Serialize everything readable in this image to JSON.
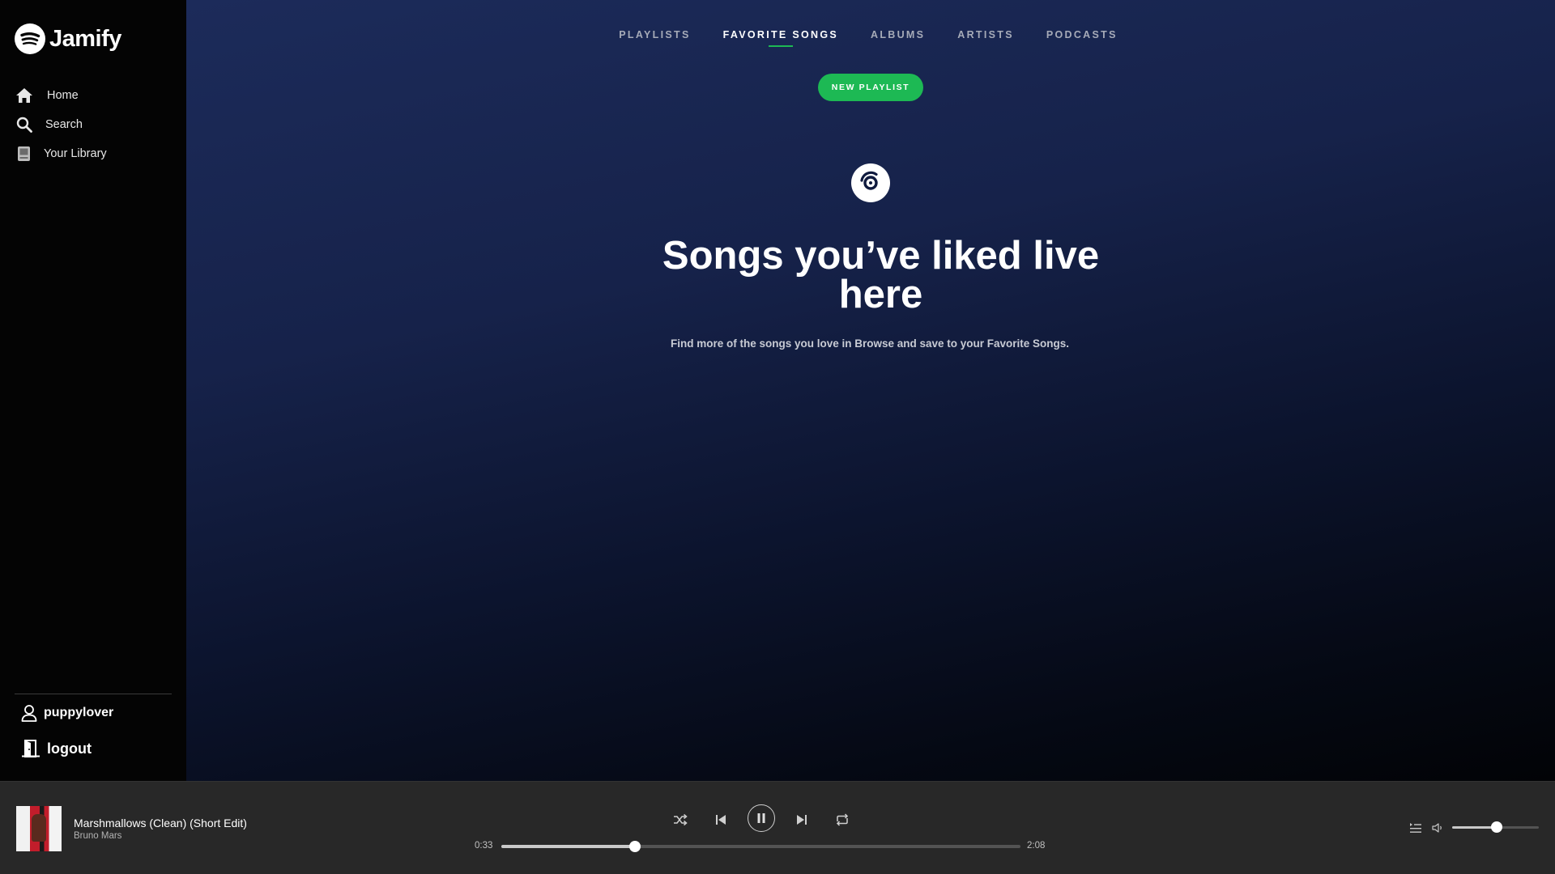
{
  "app": {
    "name": "Jamify",
    "logo_icon": "jamify-logo-icon",
    "accent_color": "#1db954"
  },
  "sidebar": {
    "items": [
      {
        "label": "Home",
        "icon": "home-icon"
      },
      {
        "label": "Search",
        "icon": "search-icon"
      },
      {
        "label": "Your Library",
        "icon": "library-icon"
      }
    ],
    "user": {
      "name": "puppylover",
      "icon": "user-icon"
    },
    "logout": {
      "label": "logout",
      "icon": "logout-door-icon"
    }
  },
  "main": {
    "tabs": [
      {
        "label": "PLAYLISTS",
        "active": false
      },
      {
        "label": "FAVORITE SONGS",
        "active": true
      },
      {
        "label": "ALBUMS",
        "active": false
      },
      {
        "label": "ARTISTS",
        "active": false
      },
      {
        "label": "PODCASTS",
        "active": false
      }
    ],
    "new_playlist_label": "NEW PLAYLIST",
    "empty_state": {
      "icon": "album-disc-icon",
      "headline_line1": "Songs you’ve liked live",
      "headline_line2": "here",
      "subtext": "Find more of the songs you love in Browse and save to your Favorite Songs."
    }
  },
  "player": {
    "track_title": "Marshmallows (Clean) (Short Edit)",
    "artist": "Bruno Mars",
    "cover_icon": "album-cover-image",
    "current_time": "0:33",
    "total_time": "2:08",
    "progress_fraction": 0.258,
    "volume_fraction": 0.51,
    "state": "playing",
    "controls": {
      "shuffle": "shuffle-icon",
      "previous": "skip-previous-icon",
      "pause": "pause-icon",
      "next": "skip-next-icon",
      "repeat": "repeat-icon",
      "queue": "queue-icon",
      "volume": "volume-icon"
    }
  }
}
